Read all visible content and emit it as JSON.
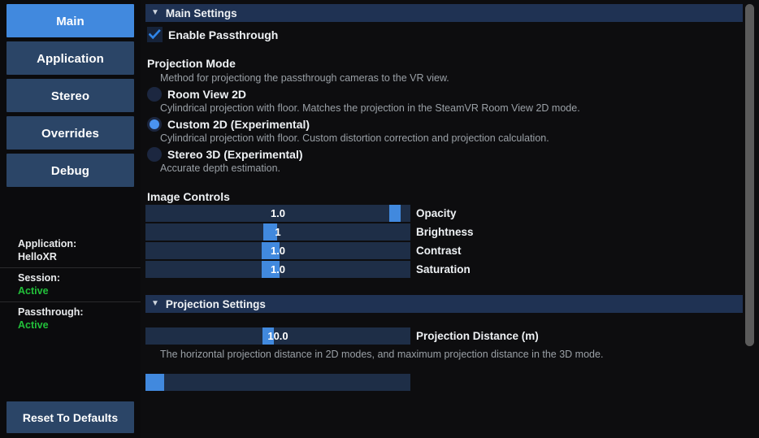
{
  "sidebar": {
    "nav_items": [
      {
        "label": "Main",
        "active": true
      },
      {
        "label": "Application",
        "active": false
      },
      {
        "label": "Stereo",
        "active": false
      },
      {
        "label": "Overrides",
        "active": false
      },
      {
        "label": "Debug",
        "active": false
      }
    ],
    "status": [
      {
        "label": "Application:",
        "value": "HelloXR",
        "state": "neutral"
      },
      {
        "label": "Session:",
        "value": "Active",
        "state": "ok"
      },
      {
        "label": "Passthrough:",
        "value": "Active",
        "state": "ok"
      }
    ],
    "reset_label": "Reset To Defaults"
  },
  "main_settings": {
    "header": "Main Settings",
    "triangle": "▼",
    "enable_passthrough": {
      "label": "Enable Passthrough",
      "checked": true
    }
  },
  "projection_mode": {
    "title": "Projection Mode",
    "description": "Method for projectiong the passthrough cameras to the VR view.",
    "options": [
      {
        "label": "Room View 2D",
        "description": "Cylindrical projection with floor. Matches the projection in the SteamVR Room View 2D mode.",
        "selected": false
      },
      {
        "label": "Custom 2D (Experimental)",
        "description": "Cylindrical projection with floor. Custom distortion correction and projection calculation.",
        "selected": true
      },
      {
        "label": "Stereo 3D (Experimental)",
        "description": "Accurate depth estimation.",
        "selected": false
      }
    ]
  },
  "image_controls": {
    "title": "Image Controls",
    "sliders": [
      {
        "label": "Opacity",
        "value": "1.0",
        "handle_pct": 96,
        "handle_w": 14
      },
      {
        "label": "Brightness",
        "value": "1",
        "handle_pct": 47,
        "handle_w": 17
      },
      {
        "label": "Contrast",
        "value": "1.0",
        "handle_pct": 47,
        "handle_w": 22
      },
      {
        "label": "Saturation",
        "value": "1.0",
        "handle_pct": 47,
        "handle_w": 22
      }
    ]
  },
  "projection_settings": {
    "header": "Projection Settings",
    "triangle": "▼",
    "distance_slider": {
      "label": "Projection Distance (m)",
      "value": "10.0",
      "handle_pct": 46,
      "handle_w": 14
    },
    "distance_description": "The horizontal projection distance in 2D modes, and maximum projection distance in the 3D mode.",
    "next_slider": {
      "value": "",
      "handle_pct": 0,
      "handle_w": 23
    }
  },
  "colors": {
    "accent": "#4189de",
    "nav_inactive": "#2b4567",
    "section_header": "#1f3253",
    "slider_track": "#1e2e47",
    "status_ok": "#22c03a",
    "background": "#0d0d0f"
  }
}
